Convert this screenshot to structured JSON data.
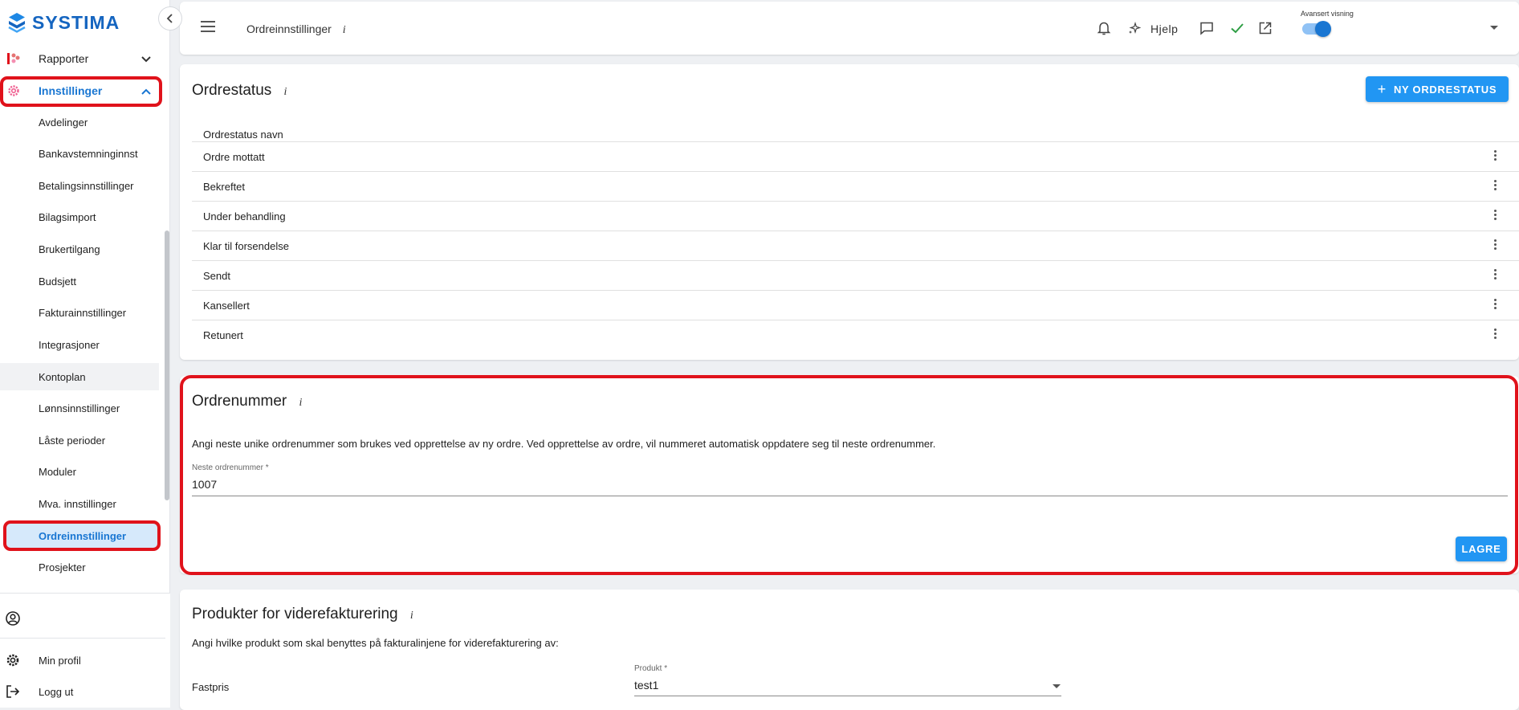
{
  "sidebar": {
    "logo_text": "SYSTIMA",
    "groups": [
      {
        "label": "Rapporter",
        "icon": "reports-icon",
        "expanded": false
      },
      {
        "label": "Innstillinger",
        "icon": "settings-gear-icon",
        "expanded": true
      }
    ],
    "items": [
      {
        "label": "Avdelinger"
      },
      {
        "label": "Bankavstemninginnst"
      },
      {
        "label": "Betalingsinnstillinger"
      },
      {
        "label": "Bilagsimport"
      },
      {
        "label": "Brukertilgang"
      },
      {
        "label": "Budsjett"
      },
      {
        "label": "Fakturainnstillinger"
      },
      {
        "label": "Integrasjoner"
      },
      {
        "label": "Kontoplan"
      },
      {
        "label": "Lønnsinnstillinger"
      },
      {
        "label": "Låste perioder"
      },
      {
        "label": "Moduler"
      },
      {
        "label": "Mva. innstillinger"
      },
      {
        "label": "Ordreinnstillinger"
      },
      {
        "label": "Prosjekter"
      }
    ],
    "active_item": "Ordreinnstillinger",
    "bottom": {
      "min_profil": "Min profil",
      "logg_ut": "Logg ut"
    }
  },
  "topbar": {
    "title": "Ordreinnstillinger",
    "info": "i",
    "help_label": "Hjelp",
    "advanced_label": "Avansert visning",
    "advanced_on": true
  },
  "ordrestatus": {
    "title": "Ordrestatus",
    "info": "i",
    "new_button": "NY ORDRESTATUS",
    "column_header": "Ordrestatus navn",
    "rows": [
      "Ordre mottatt",
      "Bekreftet",
      "Under behandling",
      "Klar til forsendelse",
      "Sendt",
      "Kansellert",
      "Retunert"
    ]
  },
  "ordrenummer": {
    "title": "Ordrenummer",
    "info": "i",
    "description": "Angi neste unike ordrenummer som brukes ved opprettelse av ny ordre. Ved opprettelse av ordre, vil nummeret automatisk oppdatere seg til neste ordrenummer.",
    "field_label": "Neste ordrenummer *",
    "field_value": "1007",
    "save_button": "LAGRE"
  },
  "produkter": {
    "title": "Produkter for viderefakturering",
    "info": "i",
    "description": "Angi hvilke produkt som skal benyttes på fakturalinjene for viderefakturering av:",
    "row_label": "Fastpris",
    "field_label": "Produkt *",
    "field_value": "test1"
  },
  "colors": {
    "accent": "#1976d2",
    "primary_button": "#2196f3",
    "highlight": "#e0121b",
    "check": "#2e9e44"
  }
}
